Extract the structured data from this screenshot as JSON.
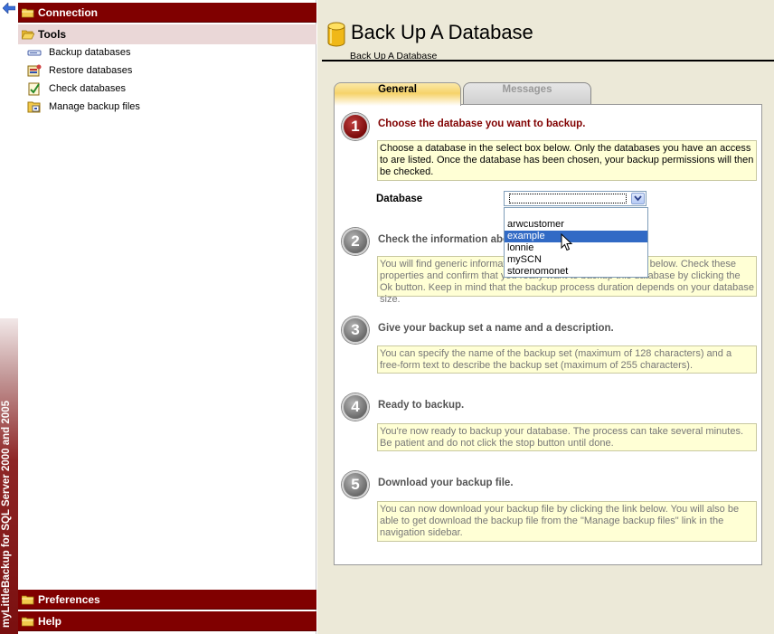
{
  "brand": {
    "vertical_text": "myLittleBackup for SQL Server 2000 and 2005"
  },
  "sidebar": {
    "connection_label": "Connection",
    "tools_label": "Tools",
    "tools": [
      {
        "label": "Backup databases",
        "icon": "backup-icon"
      },
      {
        "label": "Restore databases",
        "icon": "restore-icon"
      },
      {
        "label": "Check databases",
        "icon": "check-icon"
      },
      {
        "label": "Manage backup files",
        "icon": "manage-files-icon"
      }
    ],
    "preferences_label": "Preferences",
    "help_label": "Help"
  },
  "header": {
    "title": "Back Up A Database",
    "breadcrumb": "Back Up A Database"
  },
  "tabs": [
    {
      "label": "General",
      "active": true
    },
    {
      "label": "Messages",
      "active": false
    }
  ],
  "steps": [
    {
      "number": "1",
      "title": "Choose the database you want to backup.",
      "text": "Choose a database in the select box below. Only the databases you have an access to are listed. Once the database has been chosen, your backup permissions will then be checked.",
      "active": true
    },
    {
      "number": "2",
      "title": "Check the information about the database.",
      "text": "You will find generic information about the selected database below. Check these properties and confirm that you really want to backup this database by clicking the Ok button. Keep in mind that the backup process duration depends on your database size.",
      "active": false
    },
    {
      "number": "3",
      "title": "Give your backup set a name and a description.",
      "text": "You can specify the name of the backup set (maximum of 128 characters) and a free-form text to describe the backup set (maximum of 255 characters).",
      "active": false
    },
    {
      "number": "4",
      "title": "Ready to backup.",
      "text": "You're now ready to backup your database. The process can take several minutes. Be patient and do not click the stop button until done.",
      "active": false
    },
    {
      "number": "5",
      "title": "Download your backup file.",
      "text": "You can now download your backup file by clicking the link below. You will also be able to get download the backup file from the \"Manage backup files\" link in the navigation sidebar.",
      "active": false
    }
  ],
  "database_select": {
    "label": "Database",
    "value": "",
    "options": [
      "arwcustomer",
      "example",
      "lonnie",
      "mySCN",
      "storenomonet"
    ],
    "highlighted": "example"
  },
  "colors": {
    "accent": "#800000",
    "highlight": "#316ac5",
    "info_box": "#ffffd5"
  }
}
